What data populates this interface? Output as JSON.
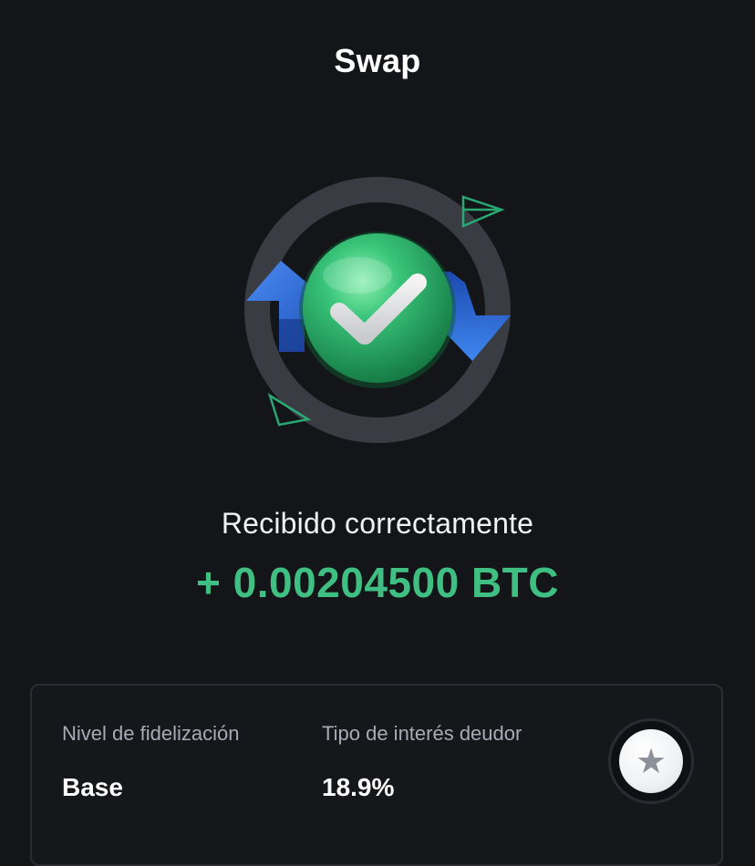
{
  "header": {
    "title": "Swap"
  },
  "status": {
    "message": "Recibido correctamente",
    "amount": "+ 0.00204500 BTC"
  },
  "info": {
    "loyalty_label": "Nivel de fidelización",
    "loyalty_value": "Base",
    "interest_label": "Tipo de interés deudor",
    "interest_value": "18.9%"
  },
  "icons": {
    "hero": "swap-success-icon",
    "tier": "star-icon"
  },
  "colors": {
    "background": "#141519",
    "amount_green": "#3fbf82",
    "check_green": "#2fa866",
    "arrow_blue": "#2f6fe0",
    "ring_gray": "#3a3c44"
  }
}
